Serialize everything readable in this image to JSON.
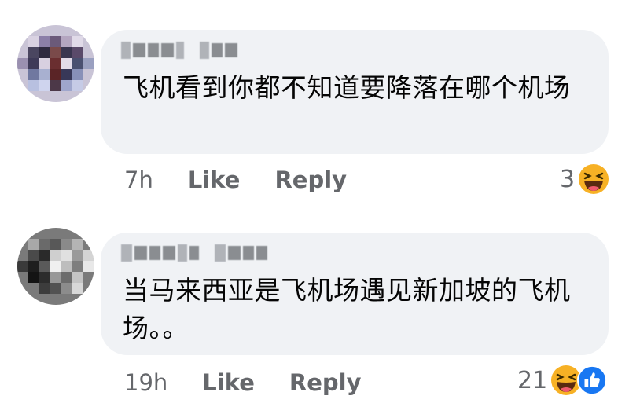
{
  "comments": [
    {
      "text": "飞机看到你都不知道要降落在哪个机场",
      "time": "7h",
      "like_label": "Like",
      "reply_label": "Reply",
      "reaction_count": "3",
      "reactions": [
        "haha-icon"
      ]
    },
    {
      "text": "当马来西亚是飞机场遇见新加坡的飞机场。。",
      "time": "19h",
      "like_label": "Like",
      "reply_label": "Reply",
      "reaction_count": "21",
      "reactions": [
        "haha-icon",
        "like-icon"
      ]
    }
  ],
  "colors": {
    "bubble": "#f0f2f5",
    "text": "#050505",
    "meta": "#65676b",
    "haha": "#f7b125",
    "like": "#1877f2"
  }
}
